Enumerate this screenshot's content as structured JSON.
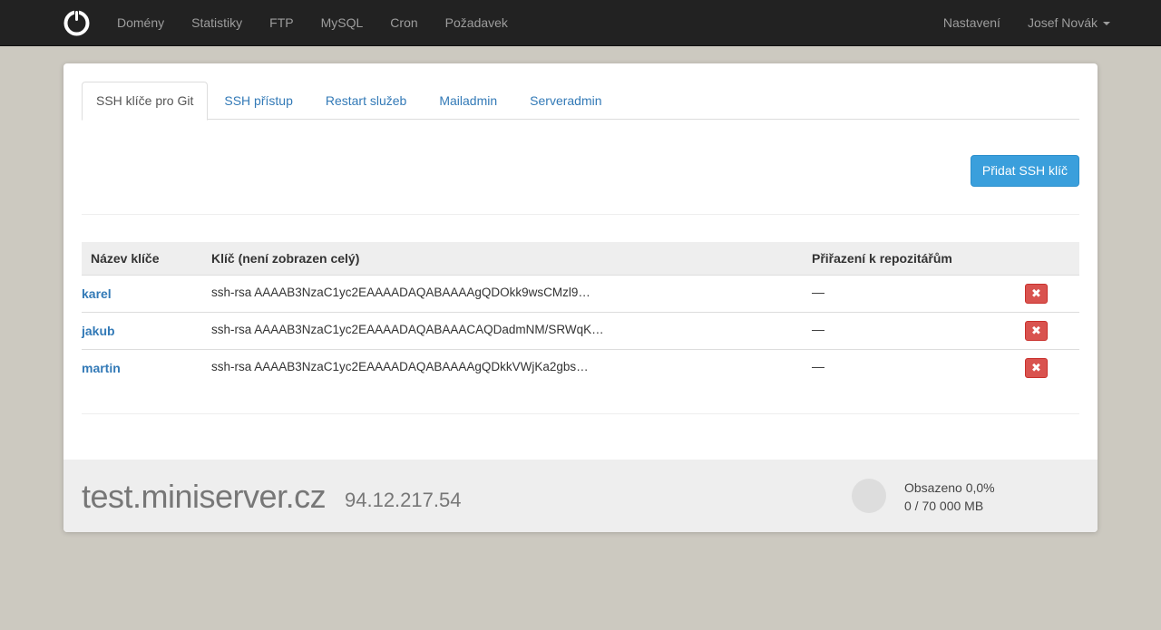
{
  "nav": {
    "logo_icon": "power-logo-icon",
    "items": [
      "Domény",
      "Statistiky",
      "FTP",
      "MySQL",
      "Cron",
      "Požadavek"
    ],
    "settings": "Nastavení",
    "user": "Josef Novák"
  },
  "tabs": [
    {
      "label": "SSH klíče pro Git",
      "active": true
    },
    {
      "label": "SSH přístup",
      "active": false
    },
    {
      "label": "Restart služeb",
      "active": false
    },
    {
      "label": "Mailadmin",
      "active": false
    },
    {
      "label": "Serveradmin",
      "active": false
    }
  ],
  "add_button": "Přidat SSH klíč",
  "table": {
    "headers": {
      "name": "Název klíče",
      "key": "Klíč (není zobrazen celý)",
      "repos": "Přiřazení k repozitářům"
    },
    "rows": [
      {
        "name": "karel",
        "key": "ssh-rsa AAAAB3NzaC1yc2EAAAADAQABAAAAgQDOkk9wsCMzl9…",
        "repos": "—"
      },
      {
        "name": "jakub",
        "key": "ssh-rsa AAAAB3NzaC1yc2EAAAADAQABAAACAQDadmNM/SRWqK…",
        "repos": "—"
      },
      {
        "name": "martin",
        "key": "ssh-rsa AAAAB3NzaC1yc2EAAAADAQABAAAAgQDkkVWjKa2gbs…",
        "repos": "—"
      }
    ],
    "delete_icon": "close-icon",
    "delete_glyph": "✖"
  },
  "footer": {
    "hostname": "test.miniserver.cz",
    "ip": "94.12.217.54",
    "disk_used": "Obsazeno 0,0%",
    "disk_capacity": "0 / 70 000 MB",
    "disk_fraction": 0.0
  },
  "colors": {
    "navbar": "#222222",
    "background": "#ccc9c0",
    "primary": "#3a9fdc",
    "danger": "#d9534f",
    "link": "#337ab7"
  }
}
